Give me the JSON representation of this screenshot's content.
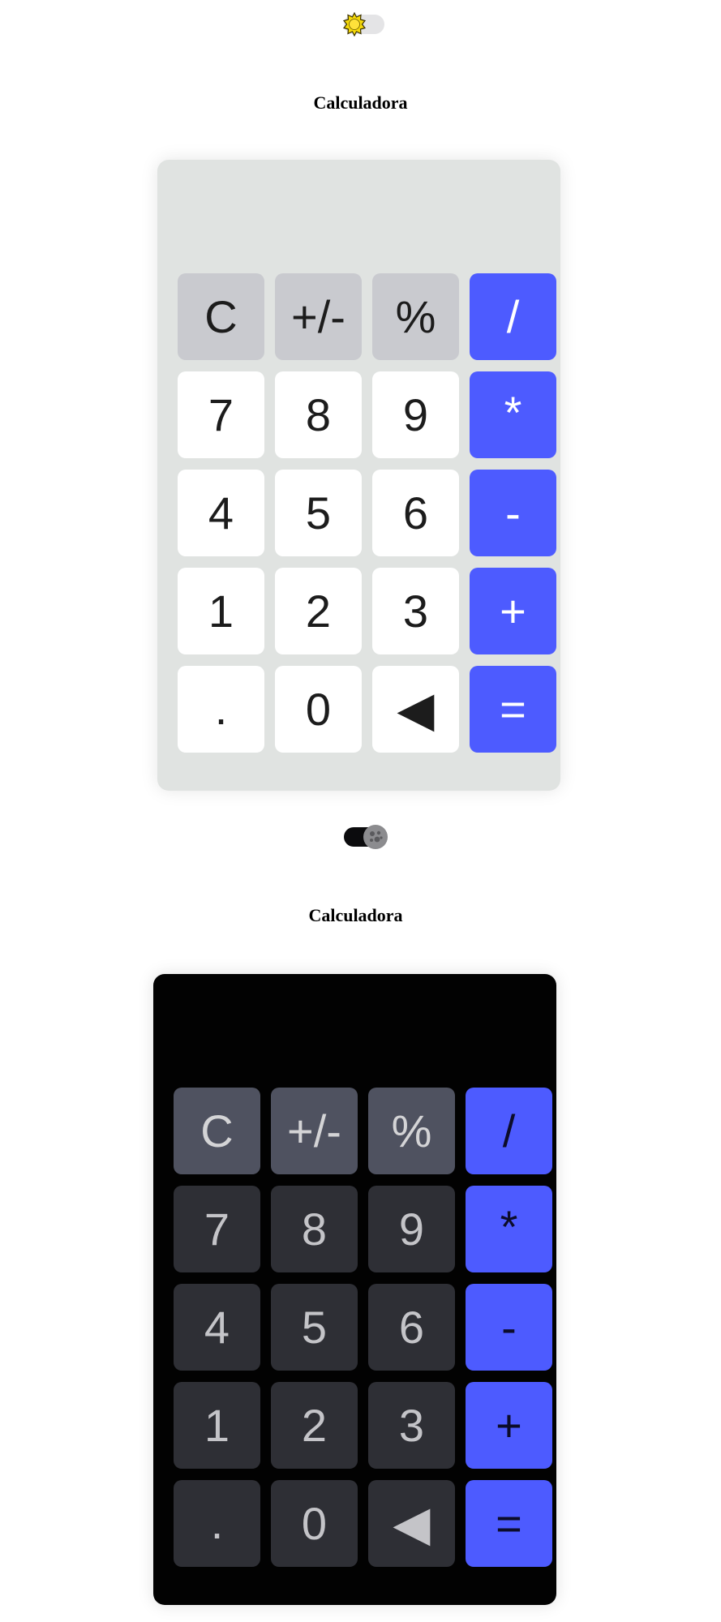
{
  "light": {
    "title": "Calculadora",
    "display": "",
    "toggle_icon": "sun-icon",
    "theme": "light"
  },
  "dark": {
    "title": "Calculadora",
    "display": "",
    "toggle_icon": "moon-icon",
    "theme": "dark"
  },
  "keys": [
    {
      "label": "C",
      "type": "fn",
      "name": "clear-button"
    },
    {
      "label": "+/-",
      "type": "fn",
      "name": "sign-toggle-button"
    },
    {
      "label": "%",
      "type": "fn",
      "name": "percent-button"
    },
    {
      "label": "/",
      "type": "op",
      "name": "divide-button"
    },
    {
      "label": "7",
      "type": "num",
      "name": "digit-7-button"
    },
    {
      "label": "8",
      "type": "num",
      "name": "digit-8-button"
    },
    {
      "label": "9",
      "type": "num",
      "name": "digit-9-button"
    },
    {
      "label": "*",
      "type": "op",
      "name": "multiply-button"
    },
    {
      "label": "4",
      "type": "num",
      "name": "digit-4-button"
    },
    {
      "label": "5",
      "type": "num",
      "name": "digit-5-button"
    },
    {
      "label": "6",
      "type": "num",
      "name": "digit-6-button"
    },
    {
      "label": "-",
      "type": "op",
      "name": "subtract-button"
    },
    {
      "label": "1",
      "type": "num",
      "name": "digit-1-button"
    },
    {
      "label": "2",
      "type": "num",
      "name": "digit-2-button"
    },
    {
      "label": "3",
      "type": "num",
      "name": "digit-3-button"
    },
    {
      "label": "+",
      "type": "op",
      "name": "add-button"
    },
    {
      "label": ".",
      "type": "num",
      "name": "decimal-button"
    },
    {
      "label": "0",
      "type": "num",
      "name": "digit-0-button"
    },
    {
      "label": "◀",
      "type": "num",
      "name": "backspace-button"
    },
    {
      "label": "=",
      "type": "op",
      "name": "equals-button"
    }
  ],
  "colors": {
    "accent": "#4d5bff",
    "light_panel": "#e0e3e1",
    "dark_panel": "#020202"
  }
}
